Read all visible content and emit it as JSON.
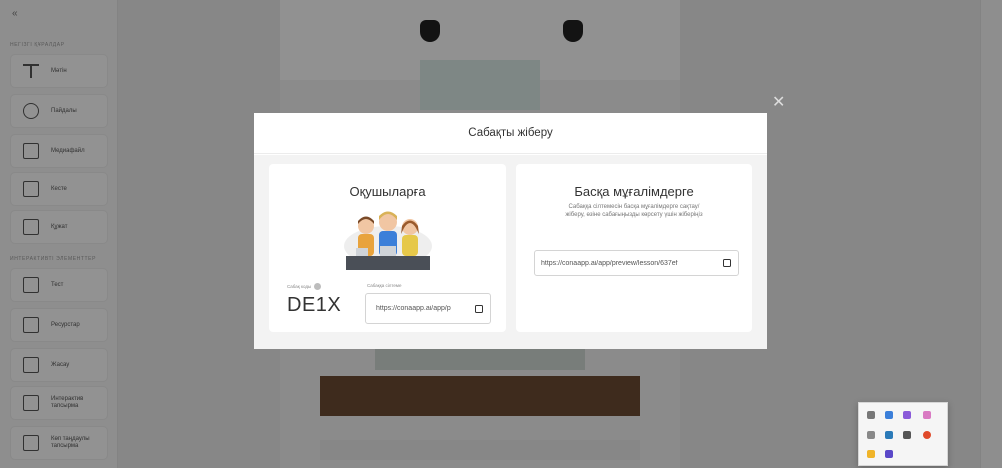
{
  "modal": {
    "title": "Сабақты жіберу",
    "students": {
      "title": "Оқушыларға",
      "code_label": "Сабақ коды",
      "code": "DE1X",
      "link_label": "Сабаққа сілтеме",
      "link": "https://conaapp.ai/app/p"
    },
    "teachers": {
      "title": "Басқа мұғалімдерге",
      "description": "Сабаққа сілтемесін басқа мұғалімдерге сақтау/жіберу, өзіне сабағыңызды көрсету үшін жіберіңіз",
      "link": "https://conaapp.ai/app/preview/lesson/637ef"
    },
    "close_glyph": "✕"
  },
  "sidebar": {
    "collapse_glyph": "«",
    "section1": "Негізгі құралдар",
    "section2": "Интерактивті элементтер",
    "tools": [
      {
        "label": "Мәтін"
      },
      {
        "label": "Пайдалы"
      },
      {
        "label": "Медиафайл"
      },
      {
        "label": "Кесте"
      },
      {
        "label": "Құжат"
      },
      {
        "label": "Тест"
      },
      {
        "label": "Ресурстар"
      },
      {
        "label": "Жасау"
      },
      {
        "label": "Интерактив тапсырма"
      },
      {
        "label": "Көп таңдаулы тапсырма"
      }
    ]
  },
  "colors": {
    "overlay": "rgba(0,0,0,0.42)",
    "modal_bg": "#ffffff",
    "body_bg": "#f3f3f3"
  }
}
